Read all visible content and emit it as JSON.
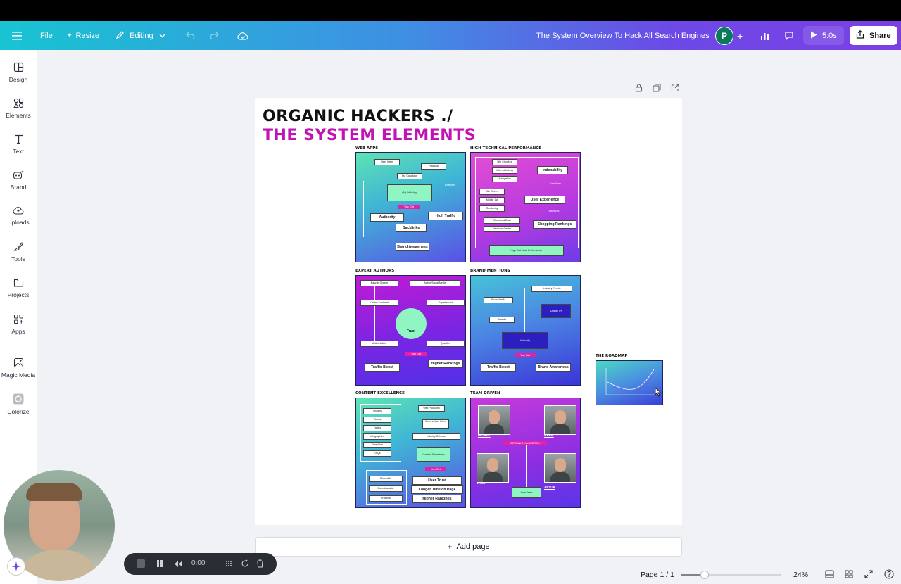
{
  "topbar": {
    "file": "File",
    "resize": "Resize",
    "editing": "Editing",
    "doc_title": "The System Overview To Hack All Search Engines",
    "avatar_initial": "P",
    "play_label": "5.0s",
    "share": "Share"
  },
  "sidebar": {
    "items": [
      {
        "label": "Design",
        "icon": "design-icon"
      },
      {
        "label": "Elements",
        "icon": "elements-icon"
      },
      {
        "label": "Text",
        "icon": "text-icon"
      },
      {
        "label": "Brand",
        "icon": "brand-icon"
      },
      {
        "label": "Uploads",
        "icon": "uploads-icon"
      },
      {
        "label": "Tools",
        "icon": "tools-icon"
      },
      {
        "label": "Projects",
        "icon": "projects-icon"
      },
      {
        "label": "Apps",
        "icon": "apps-icon"
      },
      {
        "label": "Magic Media",
        "icon": "magic-media-icon"
      },
      {
        "label": "Colorize",
        "icon": "colorize-icon"
      }
    ]
  },
  "design": {
    "title_line1": "ORGANIC HACKERS ./",
    "title_line2": "THE SYSTEM ELEMENTS",
    "panels": {
      "web_apps": {
        "label": "WEB APPS",
        "boxes": [
          "User Intent",
          "Practical",
          "Tax Calculator",
          "(AI) Web App",
          "Example",
          "You Get",
          "Authority",
          "High Traffic",
          "Backlinks",
          "Brand Awareness"
        ]
      },
      "technical": {
        "label": "HIGH TECHNICAL PERFORMANCE",
        "boxes": [
          "Site Structure",
          "Internal linking",
          "Navigation",
          "Indexability",
          "Facilitates",
          "Site Speed",
          "Mobile 1st",
          "Rendering",
          "User Experience",
          "Improves",
          "Structured Data",
          "Merchant Center",
          "Shopping Rankings",
          "High Technical Performance"
        ]
      },
      "expert_authors": {
        "label": "EXPERT AUTHORS",
        "boxes": [
          "Easy to Google",
          "Active Social Media",
          "Online Footprint",
          "Experienced",
          "Trust",
          "Authoritative",
          "Qualified",
          "You Get",
          "Traffic Boost",
          "Higher Rankings"
        ]
      },
      "brand_mentions": {
        "label": "BRAND MENTIONS",
        "boxes": [
          "Industry Events",
          "Social Media",
          "(Digital) PR",
          "Awards",
          "Authority",
          "You Get",
          "Traffic Boost",
          "Brand Awareness"
        ]
      },
      "content": {
        "label": "CONTENT EXCELLENCE",
        "boxes": [
          "Well Produced",
          "Images",
          "Videos",
          "Covers User Intent",
          "Tables",
          "Infographics",
          "Industry Relevant",
          "Templates",
          "Content Excellence",
          "FAQs",
          "You Get",
          "Shareable",
          "User Trust",
          "Downloadable",
          "Longer Time on Page",
          "Practical",
          "Higher Rankings"
        ]
      },
      "team": {
        "label": "TEAM DRIVEN",
        "center": "ORGANIC HACKERS ./",
        "members": [
          "PATRYK",
          "NABIL",
          "JABO",
          "ARTUR"
        ],
        "footer": "Your Team"
      },
      "roadmap": {
        "label": "THE ROADMAP"
      }
    },
    "add_page": "Add page"
  },
  "recorder": {
    "time": "0:00"
  },
  "footer": {
    "page": "Page 1 / 1",
    "zoom": "24%",
    "zoom_level": 0.24
  }
}
